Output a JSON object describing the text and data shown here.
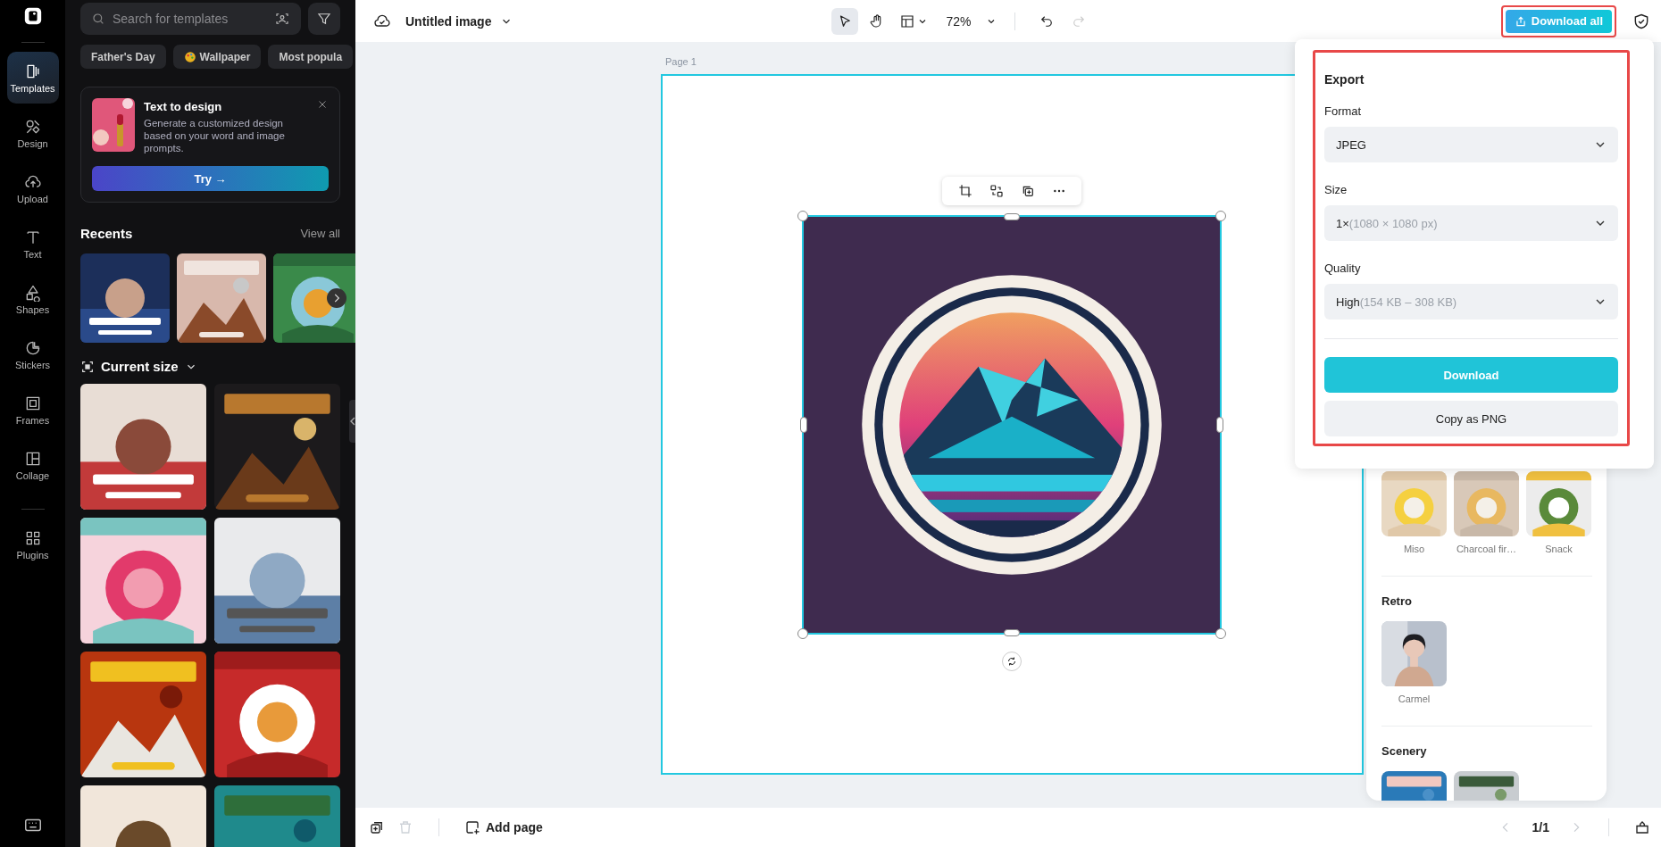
{
  "rail": {
    "items": [
      {
        "kind": "templates",
        "label": "Templates",
        "selected": true
      },
      {
        "kind": "design",
        "label": "Design",
        "selected": false
      },
      {
        "kind": "upload",
        "label": "Upload",
        "selected": false
      },
      {
        "kind": "text",
        "label": "Text",
        "selected": false
      },
      {
        "kind": "shapes",
        "label": "Shapes",
        "selected": false
      },
      {
        "kind": "stickers",
        "label": "Stickers",
        "selected": false
      },
      {
        "kind": "frames",
        "label": "Frames",
        "selected": false
      },
      {
        "kind": "collage",
        "label": "Collage",
        "selected": false
      },
      {
        "kind": "plugins",
        "label": "Plugins",
        "selected": false
      }
    ]
  },
  "sidebar": {
    "search": {
      "placeholder": "Search for templates"
    },
    "chips": [
      {
        "kind": "plain",
        "label": "Father's Day"
      },
      {
        "kind": "palette",
        "label": "Wallpaper"
      },
      {
        "kind": "plain",
        "label": "Most popula"
      }
    ],
    "promo": {
      "title": "Text to design",
      "description": "Generate a customized design based on your word and image prompts.",
      "button": "Try →"
    },
    "recents": {
      "title": "Recents",
      "link": "View all",
      "items": [
        {
          "kind": "picture"
        },
        {
          "kind": "picture"
        },
        {
          "kind": "picture"
        }
      ]
    },
    "current_size": {
      "title": "Current size",
      "templates": [
        {
          "kind": "picture"
        },
        {
          "kind": "picture"
        },
        {
          "kind": "picture"
        },
        {
          "kind": "picture"
        },
        {
          "kind": "picture"
        },
        {
          "kind": "picture"
        },
        {
          "kind": "picture"
        },
        {
          "kind": "picture"
        }
      ]
    }
  },
  "topbar": {
    "title": "Untitled image",
    "tools": [
      {
        "kind": "select",
        "selected": true
      },
      {
        "kind": "hand",
        "selected": false
      }
    ],
    "zoom": "72%",
    "undo": {
      "disabled": false
    },
    "redo": {
      "disabled": true
    },
    "download_all": {
      "label": "Download all",
      "highlighted": true
    }
  },
  "canvas": {
    "page_label": "Page 1",
    "image": {
      "kind": "picture",
      "selected": true
    }
  },
  "export": {
    "title": "Export",
    "highlighted": true,
    "fields": [
      {
        "label": "Format",
        "value": "JPEG"
      },
      {
        "label": "Size",
        "value": "1×",
        "detail": "(1080 × 1080 px)"
      },
      {
        "label": "Quality",
        "value": "High",
        "detail": "(154 KB – 308 KB)"
      }
    ],
    "primary": "Download",
    "secondary": "Copy as PNG"
  },
  "styles_panel": {
    "groups": [
      {
        "items": [
          {
            "kind": "picture",
            "label": "Miso"
          },
          {
            "kind": "picture",
            "label": "Charcoal fir…"
          },
          {
            "kind": "picture",
            "label": "Snack"
          }
        ]
      },
      {
        "title": "Retro",
        "items": [
          {
            "kind": "picture",
            "label": "Carmel"
          }
        ]
      },
      {
        "title": "Scenery",
        "items": [
          {
            "kind": "picture"
          },
          {
            "kind": "picture"
          }
        ]
      }
    ]
  },
  "bottombar": {
    "delete": {
      "disabled": true
    },
    "add_page": "Add page",
    "pager": "1/1",
    "prev": {
      "disabled": true
    },
    "next": {
      "disabled": true
    }
  }
}
